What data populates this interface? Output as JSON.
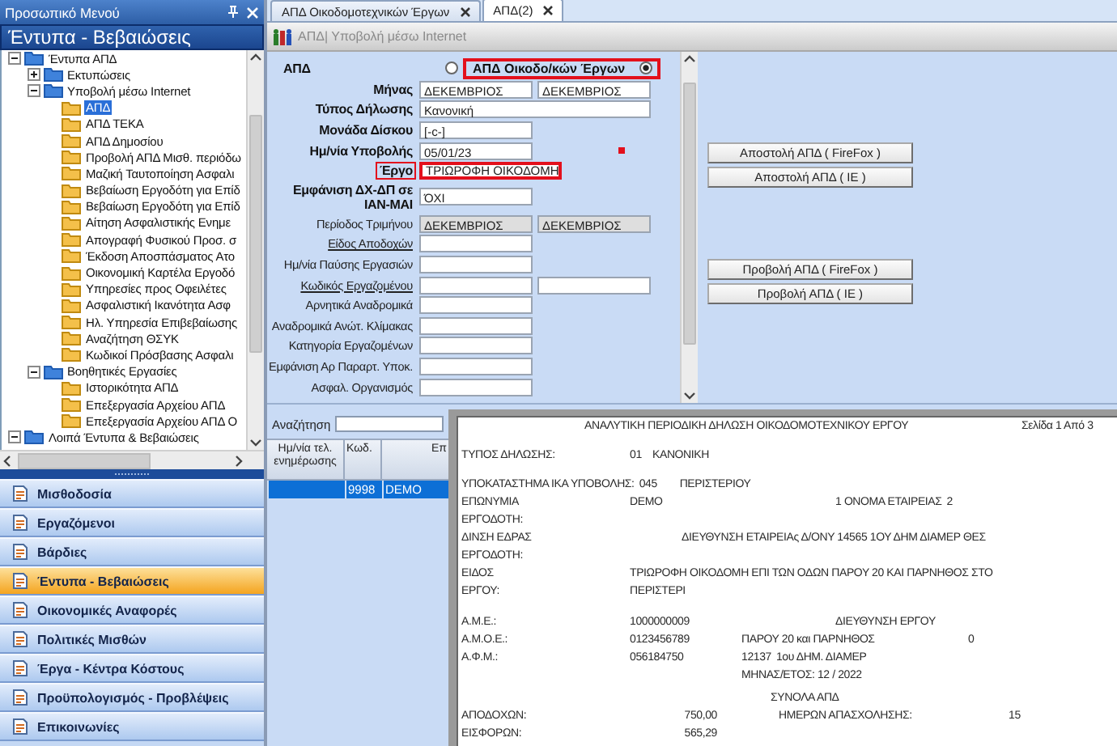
{
  "sidebar": {
    "title": "Προσωπικό Μενού",
    "header": "Έντυπα - Βεβαιώσεις",
    "tree": [
      {
        "label": "Έντυπα ΑΠΔ",
        "kind": "group",
        "expanded": true,
        "selected": false,
        "children": [
          {
            "label": "Εκτυπώσεις",
            "kind": "group",
            "expanded": false,
            "selected": false
          },
          {
            "label": "Υποβολή μέσω Internet",
            "kind": "group",
            "expanded": true,
            "selected": false,
            "children": [
              {
                "label": "ΑΠΔ",
                "kind": "leaf",
                "selected": true
              },
              {
                "label": "ΑΠΔ ΤΕΚΑ",
                "kind": "leaf",
                "selected": false
              },
              {
                "label": "ΑΠΔ Δημοσίου",
                "kind": "leaf",
                "selected": false
              },
              {
                "label": "Προβολή ΑΠΔ Μισθ. περιόδω",
                "kind": "leaf",
                "selected": false
              },
              {
                "label": "Μαζική Ταυτοποίηση Ασφαλι",
                "kind": "leaf",
                "selected": false
              },
              {
                "label": "Βεβαίωση Εργοδότη για Επίδ",
                "kind": "leaf",
                "selected": false
              },
              {
                "label": "Βεβαίωση Εργοδότη για Επίδ",
                "kind": "leaf",
                "selected": false
              },
              {
                "label": "Αίτηση Ασφαλιστικής Ενημε",
                "kind": "leaf",
                "selected": false
              },
              {
                "label": "Απογραφή Φυσικού Προσ. σ",
                "kind": "leaf",
                "selected": false
              },
              {
                "label": "Έκδοση Αποσπάσματος Ατο",
                "kind": "leaf",
                "selected": false
              },
              {
                "label": "Οικονομική Καρτέλα Εργοδό",
                "kind": "leaf",
                "selected": false
              },
              {
                "label": "Υπηρεσίες προς Οφειλέτες",
                "kind": "leaf",
                "selected": false
              },
              {
                "label": "Ασφαλιστική Ικανότητα Ασφ",
                "kind": "leaf",
                "selected": false
              },
              {
                "label": "Ηλ. Υπηρεσία Επιβεβαίωσης",
                "kind": "leaf",
                "selected": false
              },
              {
                "label": "Αναζήτηση ΘΣΥΚ",
                "kind": "leaf",
                "selected": false
              },
              {
                "label": "Κωδικοί Πρόσβασης Ασφαλι",
                "kind": "leaf",
                "selected": false
              }
            ]
          },
          {
            "label": "Βοηθητικές Εργασίες",
            "kind": "group",
            "expanded": true,
            "selected": false,
            "children": [
              {
                "label": "Ιστορικότητα ΑΠΔ",
                "kind": "leaf",
                "selected": false
              },
              {
                "label": "Επεξεργασία Αρχείου ΑΠΔ",
                "kind": "leaf",
                "selected": false
              },
              {
                "label": "Επεξεργασία Αρχείου ΑΠΔ Ο",
                "kind": "leaf",
                "selected": false
              }
            ]
          }
        ]
      },
      {
        "label": "Λοιπά Έντυπα & Βεβαιώσεις",
        "kind": "group",
        "expanded": true,
        "selected": false
      }
    ],
    "nav": [
      {
        "label": "Μισθοδοσία",
        "selected": false
      },
      {
        "label": "Εργαζόμενοι",
        "selected": false
      },
      {
        "label": "Βάρδιες",
        "selected": false
      },
      {
        "label": "Έντυπα - Βεβαιώσεις",
        "selected": true
      },
      {
        "label": "Οικονομικές Αναφορές",
        "selected": false
      },
      {
        "label": "Πολιτικές Μισθών",
        "selected": false
      },
      {
        "label": "Έργα - Κέντρα Κόστους",
        "selected": false
      },
      {
        "label": "Προϋπολογισμός - Προβλέψεις",
        "selected": false
      },
      {
        "label": "Επικοινωνίες",
        "selected": false
      }
    ]
  },
  "tabs": [
    {
      "label": "ΑΠΔ Οικοδομοτεχνικών Έργων",
      "selected": false
    },
    {
      "label": "ΑΠΔ(2)",
      "selected": true
    }
  ],
  "toolbar": {
    "title": "ΑΠΔ| Υποβολή μέσω Internet"
  },
  "form": {
    "type_row": {
      "label": "ΑΠΔ",
      "options": [
        {
          "selected": false,
          "highlighted": false
        },
        {
          "label": "ΑΠΔ Οικοδο/κών Έργων",
          "selected": true,
          "highlighted": true
        }
      ]
    },
    "rows": [
      {
        "label": "Μήνας",
        "kind": "bold",
        "highlighted": false,
        "fields": [
          {
            "value": "ΔΕΚΕΜΒΡΙΟΣ",
            "disabled": false
          },
          {
            "value": "ΔΕΚΕΜΒΡΙΟΣ",
            "disabled": false
          }
        ]
      },
      {
        "label": "Τύπος Δήλωσης",
        "kind": "bold",
        "highlighted": false,
        "fields": [
          {
            "value": "Κανονική",
            "disabled": false
          }
        ]
      },
      {
        "label": "Μονάδα Δίσκου",
        "kind": "bold",
        "highlighted": false,
        "fields": [
          {
            "value": "[-c-]",
            "disabled": false
          }
        ]
      },
      {
        "label": "Ημ/νία Υποβολής",
        "kind": "bold",
        "highlighted": false,
        "fields": [
          {
            "value": "05/01/23",
            "disabled": false
          }
        ]
      },
      {
        "label": "Έργο",
        "kind": "bold",
        "highlighted": true,
        "fields": [
          {
            "value": "ΤΡΙΩΡΟΦΗ ΟΙΚΟΔΟΜΗ",
            "disabled": false
          }
        ]
      },
      {
        "label": "Εμφάνιση ΔΧ-ΔΠ σε ΙΑΝ-ΜΑΙ",
        "kind": "bold",
        "highlighted": false,
        "fields": [
          {
            "value": "ΌΧΙ",
            "disabled": false
          }
        ]
      },
      {
        "label": "Περίοδος Τριμήνου",
        "kind": "plain",
        "highlighted": false,
        "fields": [
          {
            "value": "ΔΕΚΕΜΒΡΙΟΣ",
            "disabled": true
          },
          {
            "value": "ΔΕΚΕΜΒΡΙΟΣ",
            "disabled": true
          }
        ]
      },
      {
        "label": "Είδος Αποδοχών",
        "kind": "link",
        "highlighted": false,
        "fields": [
          {
            "disabled": false
          }
        ]
      },
      {
        "label": "Ημ/νία Παύσης Εργασιών",
        "kind": "plain",
        "highlighted": false,
        "fields": [
          {
            "disabled": false
          }
        ]
      },
      {
        "label": "Κωδικός Εργαζομένου",
        "kind": "link",
        "highlighted": false,
        "fields": [
          {
            "disabled": false
          },
          {
            "disabled": false
          }
        ]
      },
      {
        "label": "Αρνητικά Αναδρομικά",
        "kind": "plain",
        "highlighted": false,
        "fields": [
          {
            "disabled": false
          }
        ]
      },
      {
        "label": "Αναδρομικά Ανώτ. Κλίμακας",
        "kind": "plain",
        "highlighted": false,
        "fields": [
          {
            "disabled": false
          }
        ]
      },
      {
        "label": "Κατηγορία Εργαζομένων",
        "kind": "plain",
        "highlighted": false,
        "fields": [
          {
            "disabled": false
          }
        ]
      },
      {
        "label": "Εμφάνιση Αρ Παραρτ. Υποκ.",
        "kind": "plain",
        "highlighted": false,
        "fields": [
          {
            "disabled": false
          }
        ]
      },
      {
        "label": "Ασφαλ. Οργανισμός",
        "kind": "plain",
        "highlighted": false,
        "fields": [
          {
            "disabled": false
          }
        ]
      }
    ],
    "buttons": [
      [
        "Αποστολή ΑΠΔ ( FireFox )",
        "Αποστολή ΑΠΔ ( IE )"
      ],
      [
        "Προβολή ΑΠΔ ( FireFox )",
        "Προβολή ΑΠΔ ( IE )"
      ]
    ]
  },
  "search": {
    "label": "Αναζήτηση"
  },
  "list": {
    "columns": [
      "Ημ/νία τελ. ενημέρωσης",
      "Κωδ.",
      "Επ"
    ],
    "rows": [
      {
        "code": "9998",
        "name": "DEMO",
        "selected": true
      }
    ]
  },
  "report": {
    "lines": [
      [
        "ΑΝΑΛΥΤΙΚΗ ΠΕΡΙΟΔΙΚΗ ΔΗΛΩΣΗ ΟΙΚΟΔΟΜΟΤΕΧΝΙΚΟΥ ΕΡΓΟΥ",
        "Σελίδα 1 Από 3"
      ],
      [
        "ΤΥΠΟΣ ΔΗΛΩΣΗΣ:",
        "01",
        "ΚΑΝΟΝΙΚΗ"
      ],
      [
        "ΥΠΟΚΑΤΑΣΤΗΜΑ ΙΚΑ ΥΠΟΒΟΛΗΣ:",
        "045",
        "ΠΕΡΙΣΤΕΡΙΟΥ"
      ],
      [
        "ΕΠΩΝΥΜΙΑ",
        "DEMO",
        "1 ΟΝΟΜΑ ΕΤΑΙΡΕΙΑΣ",
        "2"
      ],
      [
        "ΕΡΓΟΔΟΤΗ:"
      ],
      [
        "ΔΙΝΣΗ ΕΔΡΑΣ",
        "ΔΙΕΥΘΥΝΣΗ ΕΤΑΙΡΕΙΑς Δ/ΟΝΥ 14565 1ΟΥ ΔΗΜ ΔΙΑΜΕΡ ΘΕΣ"
      ],
      [
        "ΕΡΓΟΔΟΤΗ:"
      ],
      [
        "ΕΙΔΟΣ",
        "ΤΡΙΩΡΟΦΗ ΟΙΚΟΔΟΜΗ ΕΠΙ ΤΩΝ ΟΔΩΝ ΠΑΡΟΥ 20 ΚΑΙ ΠΑΡΝΗΘΟΣ ΣΤΟ"
      ],
      [
        "ΕΡΓΟΥ:",
        "ΠΕΡΙΣΤΕΡΙ"
      ],
      [
        "Α.Μ.Ε.:",
        "1000000009",
        "ΔΙΕΥΘΥΝΣΗ ΕΡΓΟΥ"
      ],
      [
        "Α.Μ.Ο.Ε.:",
        "0123456789",
        "ΠΑΡΟΥ 20 και ΠΑΡΝΗΘΟΣ",
        "0"
      ],
      [
        "Α.Φ.Μ.:",
        "056184750",
        "12137",
        "1ου ΔΗΜ. ΔΙΑΜΕΡ"
      ],
      [
        "ΜΗΝΑΣ/ΕΤΟΣ:  12 / 2022"
      ],
      [
        "ΣΥΝΟΛΑ ΑΠΔ"
      ],
      [
        "ΑΠΟΔΟΧΩΝ:",
        "750,00",
        "ΗΜΕΡΩΝ ΑΠΑΣΧΟΛΗΣΗΣ:",
        "15"
      ],
      [
        "ΕΙΣΦΟΡΩΝ:",
        "565,29"
      ]
    ]
  }
}
